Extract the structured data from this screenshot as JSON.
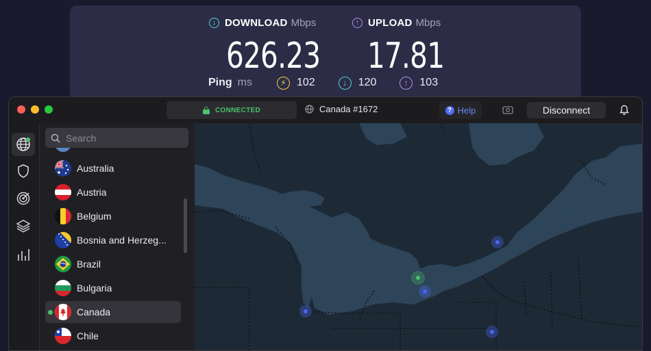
{
  "speed_test": {
    "download": {
      "label": "DOWNLOAD",
      "unit": "Mbps",
      "value": "626.23"
    },
    "upload": {
      "label": "UPLOAD",
      "unit": "Mbps",
      "value": "17.81"
    },
    "ping": {
      "label": "Ping",
      "unit": "ms",
      "items": [
        {
          "icon": "jitter-icon",
          "value": "102",
          "color": "#f2d44a"
        },
        {
          "icon": "download-ping-icon",
          "value": "120",
          "color": "#55d6d0"
        },
        {
          "icon": "upload-ping-icon",
          "value": "103",
          "color": "#b590f0"
        }
      ]
    },
    "colors": {
      "download": "#55d6d0",
      "upload": "#b590f0",
      "jitter": "#f2d44a"
    }
  },
  "app": {
    "status": "CONNECTED",
    "status_color": "#4cc16b",
    "server": "Canada #1672",
    "help_label": "Help",
    "disconnect_label": "Disconnect",
    "search": {
      "placeholder": "Search",
      "value": ""
    },
    "rail_icons": [
      "globe-icon",
      "shield-icon",
      "target-icon",
      "layers-icon",
      "stats-icon"
    ],
    "countries": [
      {
        "name": "Australia",
        "flag": "australia-flag-icon",
        "selected": false
      },
      {
        "name": "Austria",
        "flag": "austria-flag-icon",
        "selected": false
      },
      {
        "name": "Belgium",
        "flag": "belgium-flag-icon",
        "selected": false
      },
      {
        "name": "Bosnia and Herzeg...",
        "flag": "bosnia-flag-icon",
        "selected": false
      },
      {
        "name": "Brazil",
        "flag": "brazil-flag-icon",
        "selected": false
      },
      {
        "name": "Bulgaria",
        "flag": "bulgaria-flag-icon",
        "selected": false
      },
      {
        "name": "Canada",
        "flag": "canada-flag-icon",
        "selected": true
      },
      {
        "name": "Chile",
        "flag": "chile-flag-icon",
        "selected": false
      }
    ],
    "map": {
      "water_color": "#2d4459",
      "land_color": "#1d2935",
      "server_dot_color": "#4a66f0",
      "active_dot_color": "#4cc16b"
    }
  }
}
